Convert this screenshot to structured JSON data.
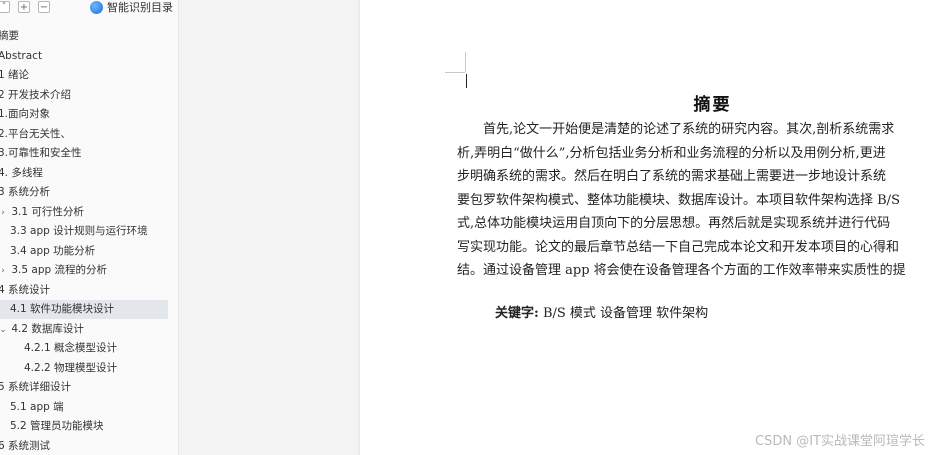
{
  "toolbar": {
    "collapse_icon": "collapse-icon",
    "expand_icon": "expand-icon",
    "remove_icon": "remove-icon",
    "smart_toc_label": "智能识别目录"
  },
  "toc": [
    {
      "label": "摘要",
      "indent": 0,
      "chevron": ""
    },
    {
      "label": "Abstract",
      "indent": 0,
      "chevron": ""
    },
    {
      "label": "1 绪论",
      "indent": 0,
      "chevron": ""
    },
    {
      "label": "2 开发技术介绍",
      "indent": 0,
      "chevron": ""
    },
    {
      "label": "1.面向对象",
      "indent": 0,
      "chevron": ""
    },
    {
      "label": "2.平台无关性、",
      "indent": 0,
      "chevron": ""
    },
    {
      "label": "3.可靠性和安全性",
      "indent": 0,
      "chevron": ""
    },
    {
      "label": "4. 多线程",
      "indent": 0,
      "chevron": ""
    },
    {
      "label": "3 系统分析",
      "indent": 0,
      "chevron": ""
    },
    {
      "label": "3.1 可行性分析",
      "indent": 1,
      "chevron": ">"
    },
    {
      "label": "3.3 app 设计规则与运行环境",
      "indent": 1,
      "chevron": ""
    },
    {
      "label": "3.4 app 功能分析",
      "indent": 1,
      "chevron": ""
    },
    {
      "label": "3.5 app 流程的分析",
      "indent": 1,
      "chevron": ">"
    },
    {
      "label": "4 系统设计",
      "indent": 0,
      "chevron": ""
    },
    {
      "label": "4.1  软件功能模块设计",
      "indent": 1,
      "chevron": "",
      "active": true
    },
    {
      "label": "4.2  数据库设计",
      "indent": 1,
      "chevron": "v"
    },
    {
      "label": "4.2.1  概念模型设计",
      "indent": 2,
      "chevron": ""
    },
    {
      "label": "4.2.2  物理模型设计",
      "indent": 2,
      "chevron": ""
    },
    {
      "label": "5 系统详细设计",
      "indent": 0,
      "chevron": ""
    },
    {
      "label": "5.1 app 端",
      "indent": 1,
      "chevron": ""
    },
    {
      "label": "5.2 管理员功能模块",
      "indent": 1,
      "chevron": ""
    },
    {
      "label": "6 系统测试",
      "indent": 0,
      "chevron": ""
    }
  ],
  "document": {
    "title": "摘要",
    "lines": [
      "　　首先,论文一开始便是清楚的论述了系统的研究内容。其次,剖析系统需求",
      "析,弄明白“做什么”,分析包括业务分析和业务流程的分析以及用例分析,更进",
      "步明确系统的需求。然后在明白了系统的需求基础上需要进一步地设计系统",
      "要包罗软件架构模式、整体功能模块、数据库设计。本项目软件架构选择 B/S",
      "式,总体功能模块运用自顶向下的分层思想。再然后就是实现系统并进行代码",
      "写实现功能。论文的最后章节总结一下自己完成本论文和开发本项目的心得和",
      "结。通过设备管理 app 将会使在设备管理各个方面的工作效率带来实质性的提"
    ],
    "keywords_label": "关键字:",
    "keywords_text": " B/S 模式  设备管理  软件架构"
  },
  "watermark": "CSDN @IT实战课堂阿瑄学长"
}
